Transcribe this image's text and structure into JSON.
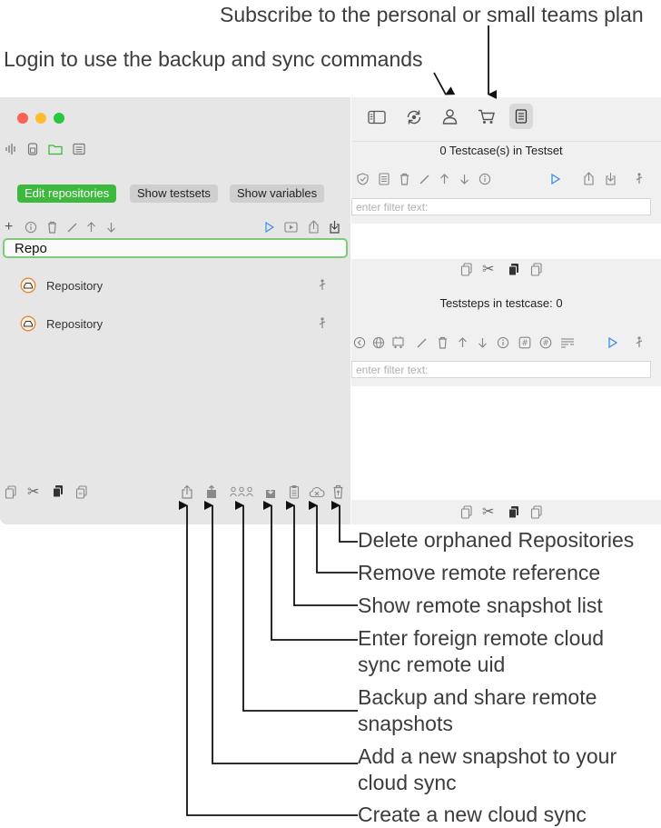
{
  "annotations": {
    "subscribe": "Subscribe to the personal or small teams plan",
    "login": "Login to use the backup and sync commands",
    "delete_orphaned": "Delete orphaned Repositories",
    "remove_remote": "Remove remote reference",
    "show_snapshot_list": "Show remote snapshot list",
    "enter_foreign_line1": "Enter foreign remote cloud",
    "enter_foreign_line2": "sync remote uid",
    "backup_share_line1": "Backup and share remote",
    "backup_share_line2": "snapshots",
    "add_snapshot_line1": "Add a new snapshot to your",
    "add_snapshot_line2": "cloud sync",
    "create_cloud_sync": "Create a new cloud sync"
  },
  "sidebar": {
    "tabs": {
      "edit_repositories": "Edit repositories",
      "show_testsets": "Show testsets",
      "show_variables": "Show variables"
    },
    "search_value": "Repo",
    "repositories": [
      {
        "label": "Repository"
      },
      {
        "label": "Repository"
      }
    ]
  },
  "testcases": {
    "header": "0 Testcase(s) in Testset",
    "filter_placeholder": "enter filter text:"
  },
  "teststeps": {
    "header": "Teststeps in testcase: 0",
    "filter_placeholder": "enter filter text:"
  },
  "colors": {
    "accent_green": "#3dba3d",
    "run_blue": "#3d8cf0",
    "close_red": "#fe5f57",
    "minimize_yellow": "#febc2e",
    "zoom_green": "#28c840"
  }
}
